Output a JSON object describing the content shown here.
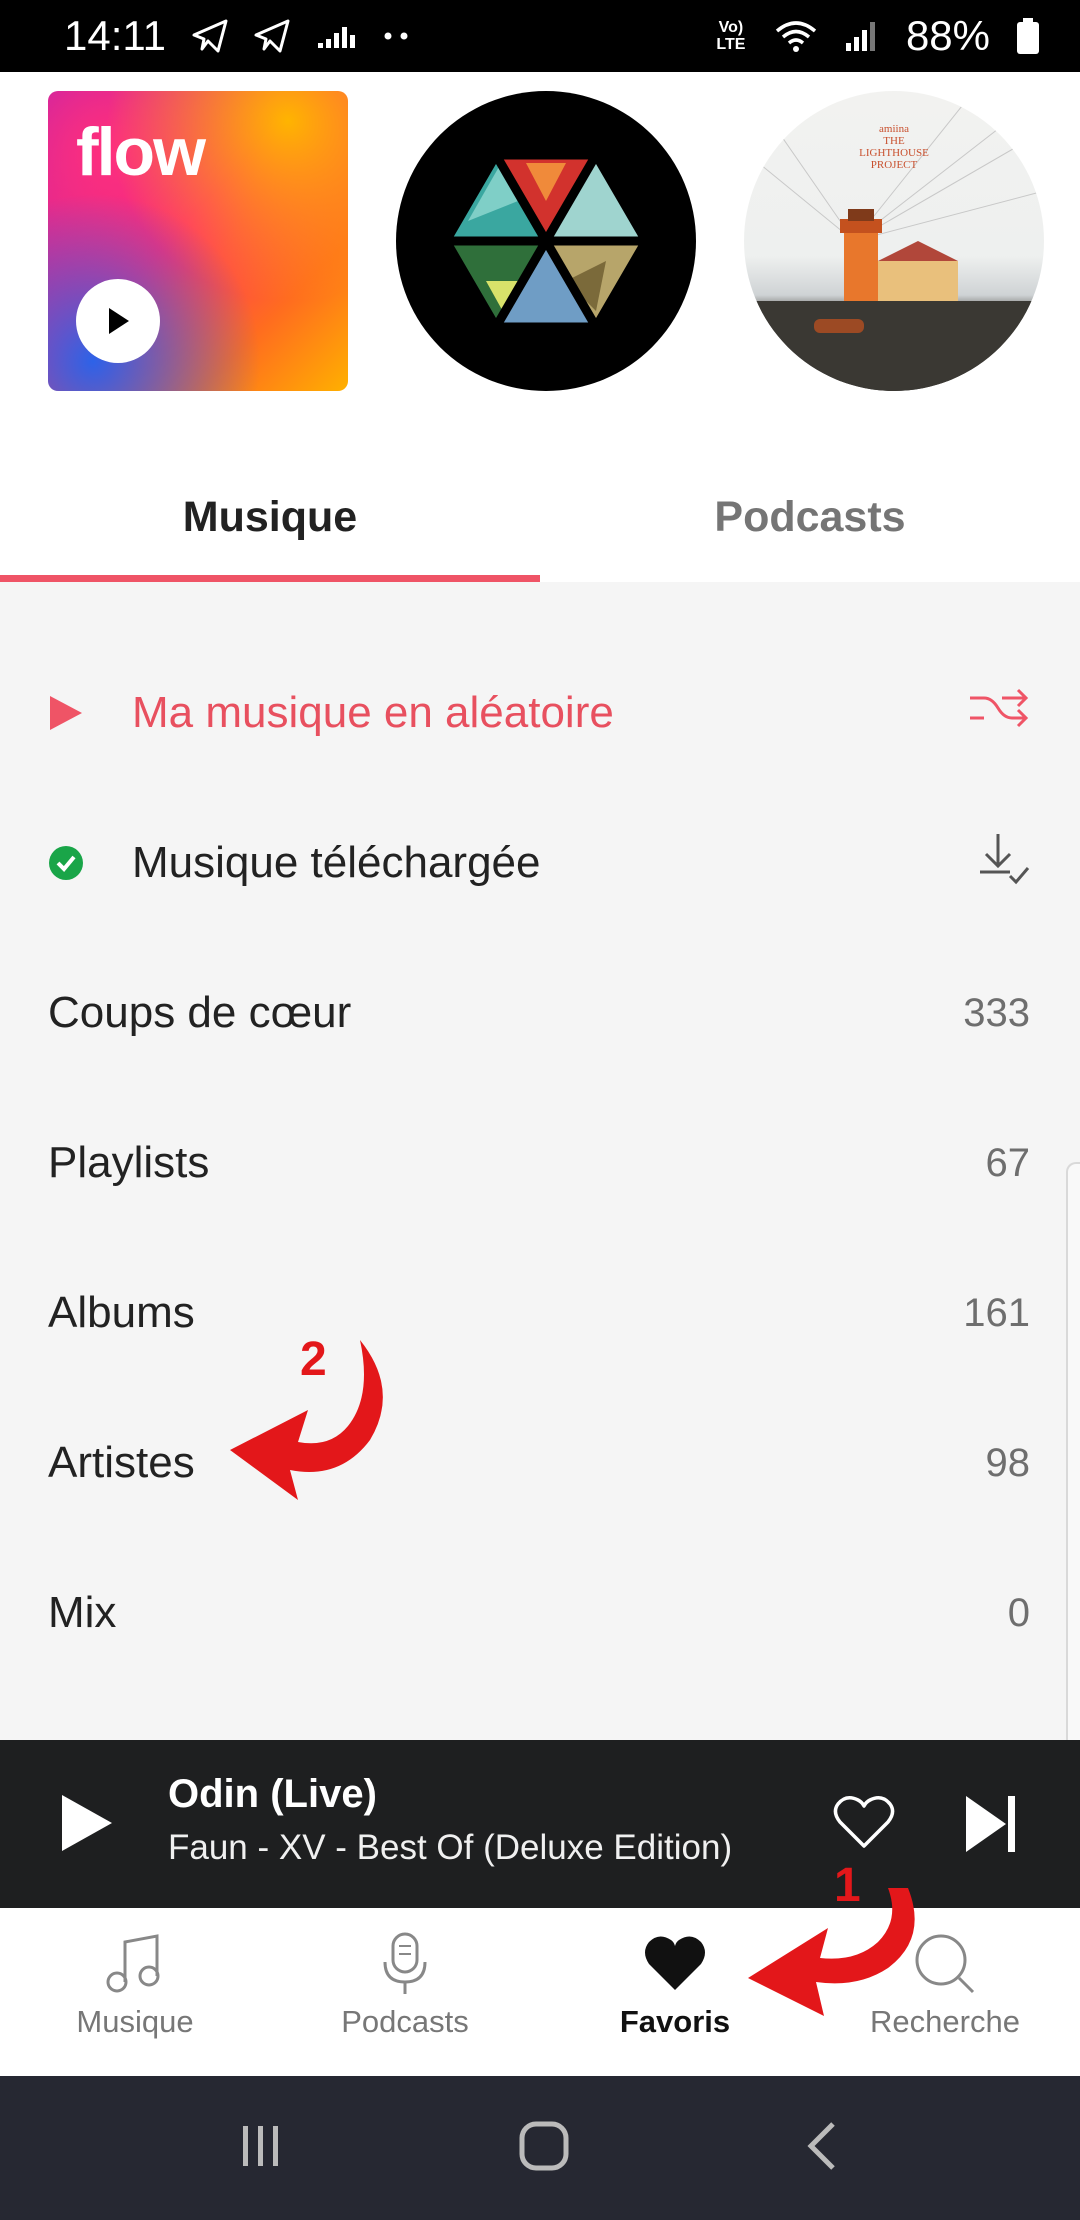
{
  "status_bar": {
    "time": "14:11",
    "network": "Vo) LTE",
    "battery": "88%",
    "icons": [
      "telegram-icon",
      "telegram-icon",
      "equalizer-icon",
      "dots-icon",
      "volte-icon",
      "wifi-icon",
      "signal-icon",
      "battery-icon"
    ]
  },
  "carousel": {
    "flow_label": "flow",
    "lighthouse_text": "amiina\nTHE\nLIGHTHOUSE\nPROJECT"
  },
  "tabs": [
    {
      "label": "Musique",
      "active": true
    },
    {
      "label": "Podcasts",
      "active": false
    }
  ],
  "list": {
    "shuffle_label": "Ma musique en aléatoire",
    "downloaded_label": "Musique téléchargée",
    "rows": [
      {
        "label": "Coups de cœur",
        "count": "333"
      },
      {
        "label": "Playlists",
        "count": "67"
      },
      {
        "label": "Albums",
        "count": "161"
      },
      {
        "label": "Artistes",
        "count": "98"
      },
      {
        "label": "Mix",
        "count": "0"
      }
    ]
  },
  "player": {
    "title": "Odin (Live)",
    "subtitle": "Faun - XV - Best Of (Deluxe Edition)"
  },
  "bottom_nav": [
    {
      "label": "Musique",
      "icon": "music-note-icon",
      "active": false
    },
    {
      "label": "Podcasts",
      "icon": "microphone-icon",
      "active": false
    },
    {
      "label": "Favoris",
      "icon": "heart-icon",
      "active": true
    },
    {
      "label": "Recherche",
      "icon": "search-icon",
      "active": false
    }
  ],
  "annotations": {
    "step1": "1",
    "step2": "2",
    "color": "#e3171a"
  },
  "colors": {
    "accent": "#ef5466",
    "player_bg": "#1e1f20",
    "download_check": "#19a548"
  }
}
